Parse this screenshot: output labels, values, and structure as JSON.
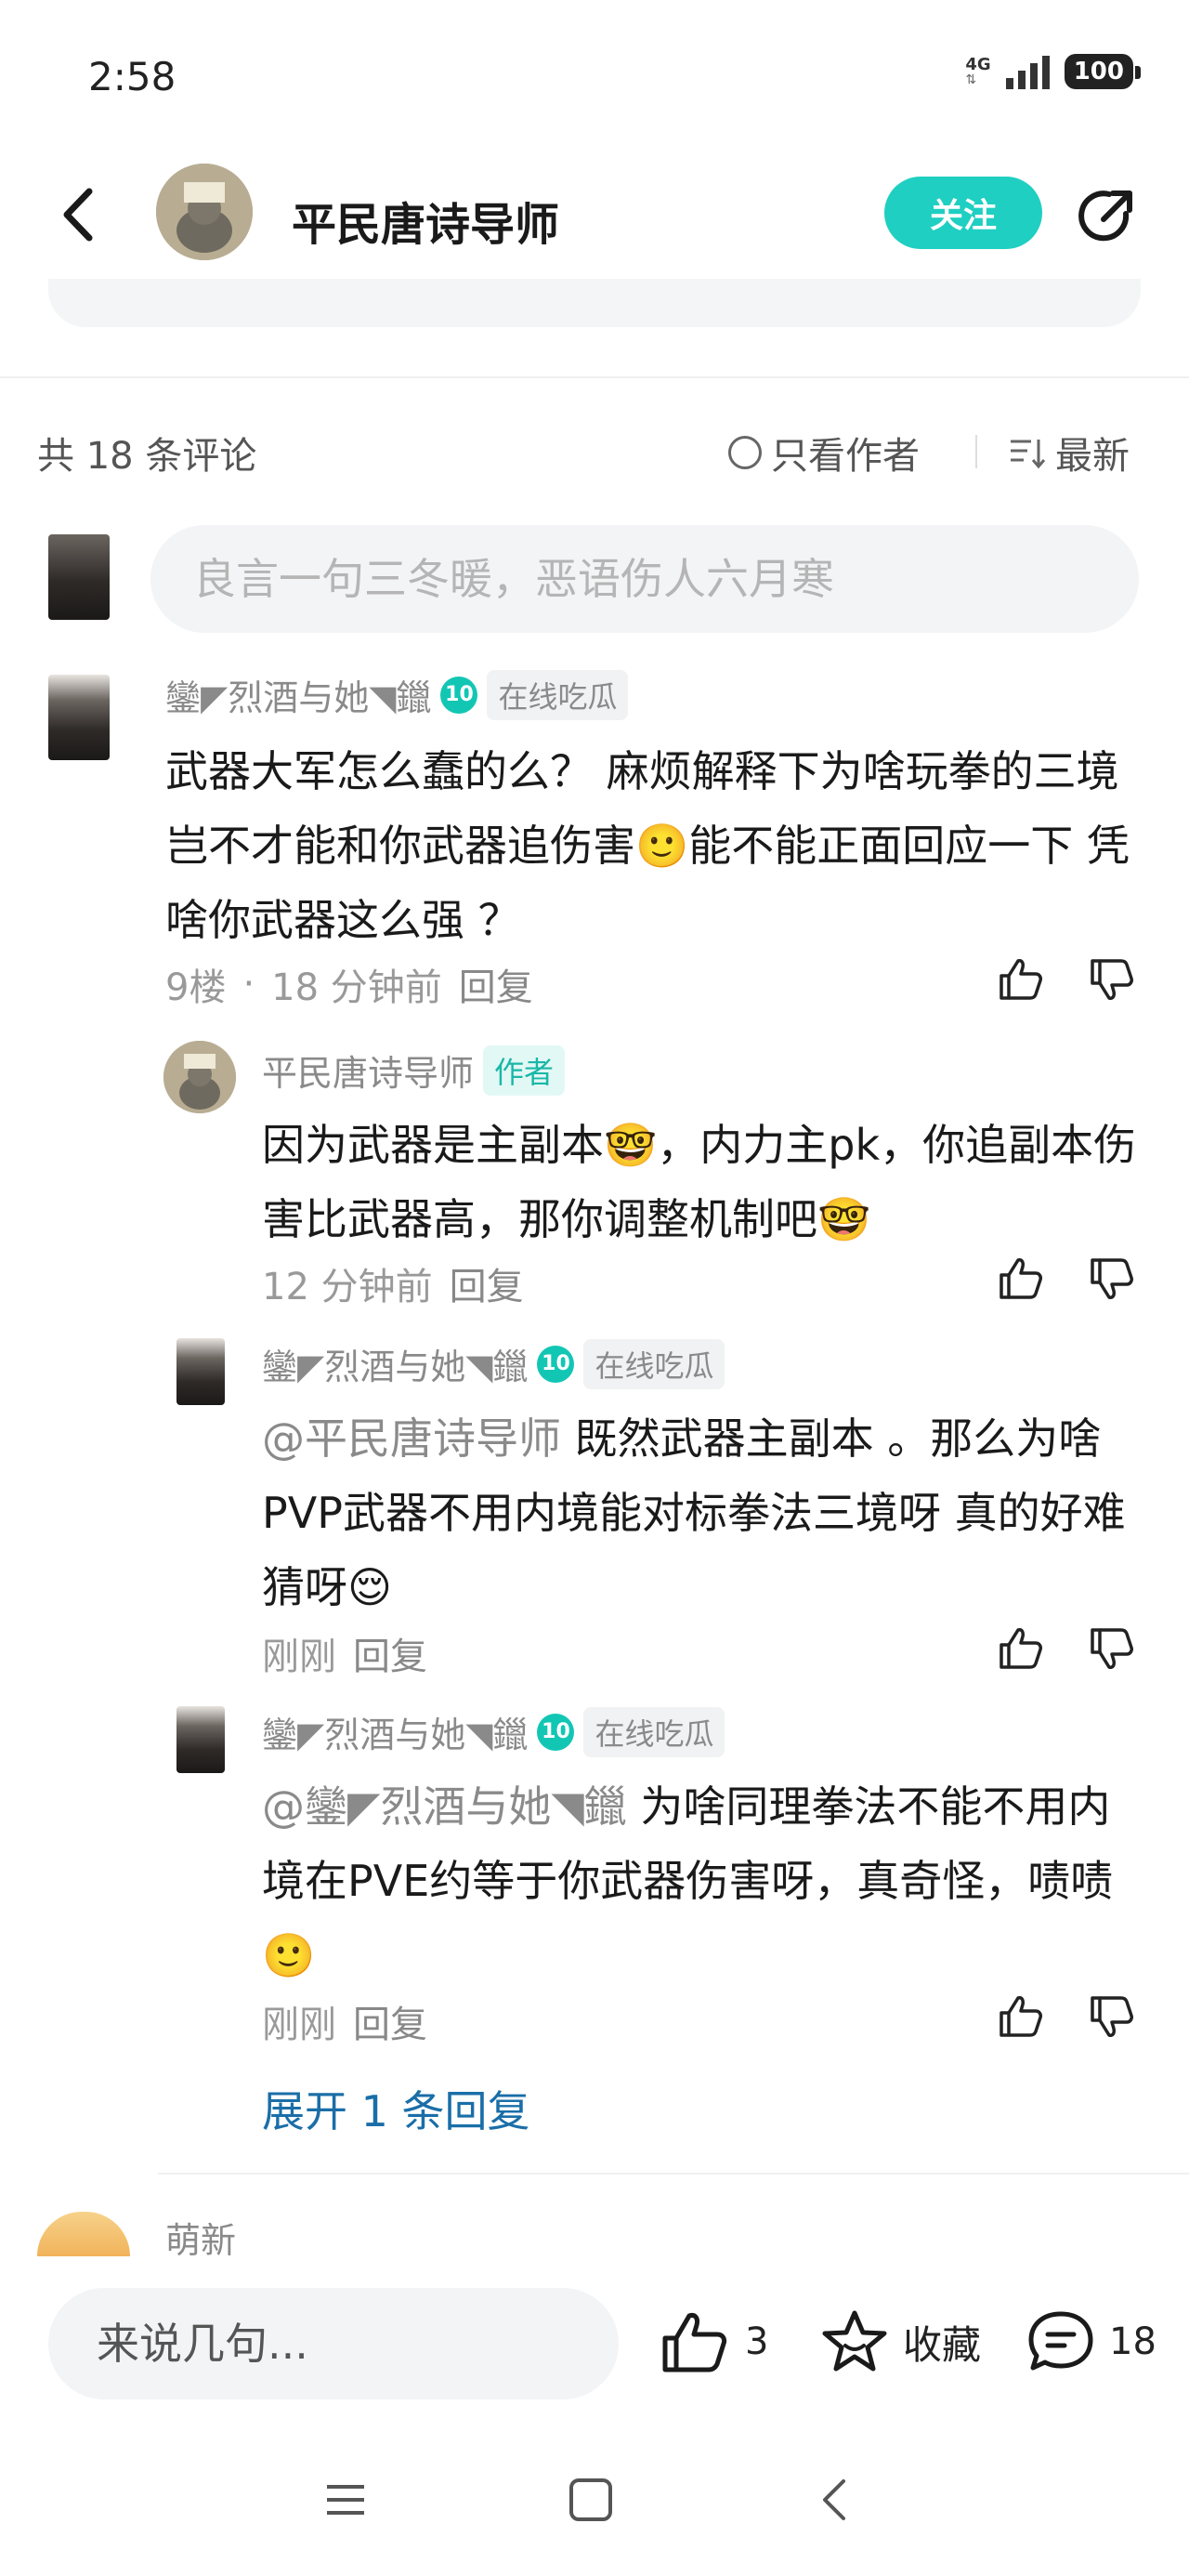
{
  "status": {
    "time": "2:58",
    "network": "4G",
    "battery": "100"
  },
  "header": {
    "title": "平民唐诗导师",
    "follow_label": "关注"
  },
  "comments_bar": {
    "count_label": "共 18 条评论",
    "author_only": "只看作者",
    "sort_label": "最新"
  },
  "comment_input": {
    "placeholder": "良言一句三冬暖，恶语伤人六月寒"
  },
  "comments": [
    {
      "user": "鑾◤烈酒与她◥鑞",
      "level": "10",
      "tag": "在线吃瓜",
      "text": "武器大军怎么蠢的么？  麻烦解释下为啥玩拳的三境岂不才能和你武器追伤害🙂能不能正面回应一下  凭啥你武器这么强 ？",
      "floor": "9楼",
      "time": "18 分钟前",
      "reply": "回复"
    }
  ],
  "replies": [
    {
      "user": "平民唐诗导师",
      "badge": "作者",
      "text": "因为武器是主副本🤓，内力主pk，你追副本伤害比武器高，那你调整机制吧🤓",
      "time": "12 分钟前",
      "reply": "回复"
    },
    {
      "user": "鑾◤烈酒与她◥鑞",
      "level": "10",
      "tag": "在线吃瓜",
      "mention": "@平民唐诗导师",
      "text": " 既然武器主副本 。那么为啥PVP武器不用内境能对标拳法三境呀  真的好难猜呀😌",
      "time": "刚刚",
      "reply": "回复"
    },
    {
      "user": "鑾◤烈酒与她◥鑞",
      "level": "10",
      "tag": "在线吃瓜",
      "mention": "@鑾◤烈酒与她◥鑞",
      "text": "  为啥同理拳法不能不用内境在PVE约等于你武器伤害呀，真奇怪，啧啧🙂",
      "time": "刚刚",
      "reply": "回复"
    }
  ],
  "expand_label": "展开 1 条回复",
  "next_comment": {
    "user": "萌新"
  },
  "bottom_bar": {
    "input_placeholder": "来说几句...",
    "like_count": "3",
    "fav_label": "收藏",
    "comment_count": "18"
  },
  "colors": {
    "accent": "#1fcfc1",
    "link": "#1a6ea8",
    "level_badge": "#12c6b4"
  }
}
